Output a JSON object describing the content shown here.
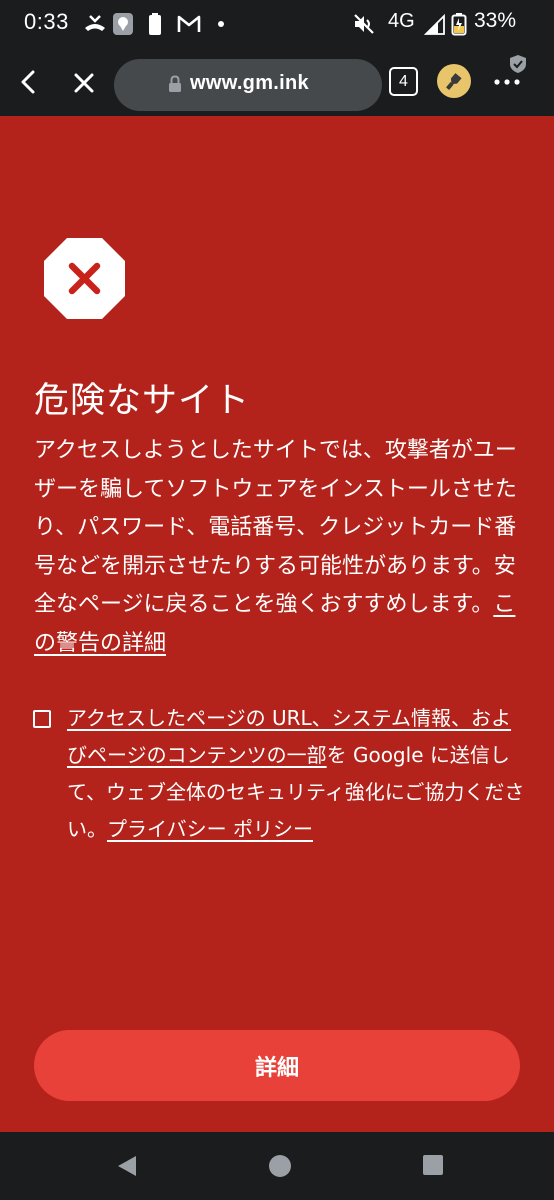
{
  "status_bar": {
    "time": "0:33",
    "network": "4G",
    "battery": "33%",
    "icons": [
      "missed-call-icon",
      "location-icon",
      "battery-icon",
      "gmail-icon",
      "dot-icon",
      "mute-icon",
      "signal-icon",
      "battery-saver-icon"
    ]
  },
  "toolbar": {
    "url": "www.gm.ink",
    "tab_count": "4",
    "icons": [
      "back-icon",
      "close-icon",
      "lock-icon",
      "extension-icon",
      "menu-icon",
      "shield-icon"
    ]
  },
  "interstitial": {
    "title": "危険なサイト",
    "body": "アクセスしようとしたサイトでは、攻撃者がユーザーを騙してソフトウェアをインストールさせたり、パスワード、電話番号、クレジットカード番号などを開示させたりする可能性があります。安全なページに戻ることを強くおすすめします。",
    "details_link": "この警告の詳細",
    "consent_link": "アクセスしたページの URL、システム情報、およびページのコンテンツの一部",
    "consent_text": "を Google に送信して、ウェブ全体のセキュリティ強化にご協力ください。",
    "privacy_link": "プライバシー ポリシー",
    "details_button": "詳細"
  },
  "colors": {
    "background": "#b3221b",
    "button": "#e8413a",
    "bar": "#1a1c1d"
  }
}
